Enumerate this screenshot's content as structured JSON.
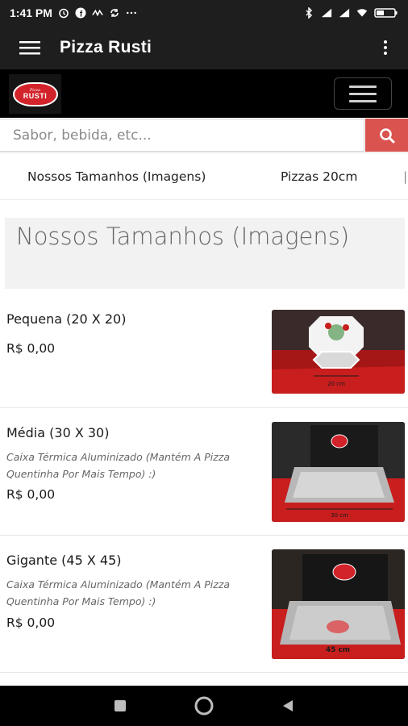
{
  "status_bar": {
    "time": "1:41 PM",
    "left_icons": [
      "alarm-icon",
      "facebook-icon",
      "dual-sim-icon",
      "sync-icon",
      "more-dots-icon"
    ],
    "right_icons": [
      "bluetooth-icon",
      "signal-icon",
      "signal-icon",
      "wifi-icon",
      "battery-icon"
    ]
  },
  "app_bar": {
    "title": "Pizza Rusti",
    "menu_icon": "hamburger-icon",
    "overflow_icon": "vertical-dots-icon"
  },
  "site_header": {
    "logo_small_text": "Pizza",
    "logo_big_text": "RUSTI",
    "nav_toggle_icon": "hamburger-icon"
  },
  "search": {
    "placeholder": "Sabor, bebida, etc...",
    "button_icon": "search-icon",
    "accent_color": "#d9534f"
  },
  "category_tabs": [
    "Nossos Tamanhos (Imagens)",
    "Pizzas 20cm"
  ],
  "section": {
    "title": "Nossos Tamanhos (Imagens)"
  },
  "products": [
    {
      "name": "Pequena (20 X 20)",
      "description": "",
      "price": "R$ 0,00",
      "image_label": "20 cm"
    },
    {
      "name": "Média (30 X 30)",
      "description": "Caixa Térmica Aluminizado (Mantém A Pizza Quentinha Por Mais Tempo) :)",
      "price": "R$ 0,00",
      "image_label": "30 cm"
    },
    {
      "name": "Gigante (45 X 45)",
      "description": "Caixa Térmica Aluminizado (Mantém A Pizza Quentinha Por Mais Tempo) :)",
      "price": "R$ 0,00",
      "image_label": "45 cm"
    }
  ],
  "nav_bar": {
    "buttons": [
      "recents-square-icon",
      "home-circle-icon",
      "back-triangle-icon"
    ]
  }
}
